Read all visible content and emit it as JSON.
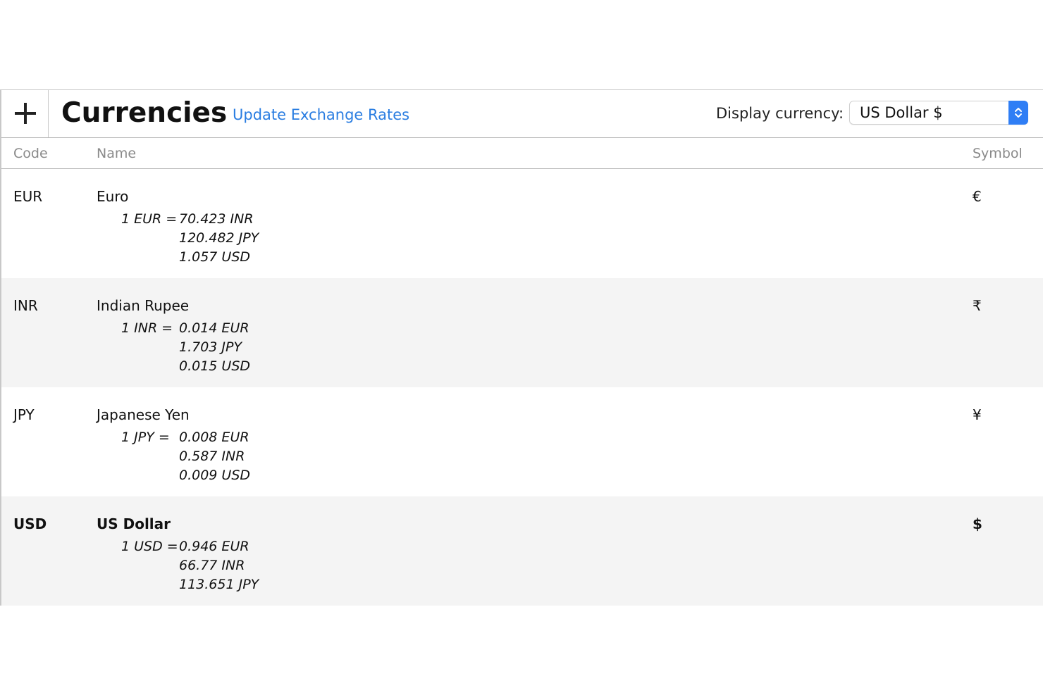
{
  "toolbar": {
    "add_label": "+",
    "title": "Currencies",
    "update_link": "Update Exchange Rates",
    "display_currency_label": "Display currency:",
    "display_currency_value": "US Dollar $"
  },
  "columns": {
    "code": "Code",
    "name": "Name",
    "symbol": "Symbol"
  },
  "rows": [
    {
      "code": "EUR",
      "name": "Euro",
      "symbol": "€",
      "lead": "1 EUR =",
      "rates": [
        "70.423 INR",
        "120.482 JPY",
        "1.057 USD"
      ],
      "selected_display": false
    },
    {
      "code": "INR",
      "name": "Indian Rupee",
      "symbol": "₹",
      "lead": "1 INR =",
      "rates": [
        "0.014 EUR",
        "1.703 JPY",
        "0.015 USD"
      ],
      "selected_display": false
    },
    {
      "code": "JPY",
      "name": "Japanese Yen",
      "symbol": "¥",
      "lead": "1 JPY =",
      "rates": [
        "0.008 EUR",
        "0.587 INR",
        "0.009 USD"
      ],
      "selected_display": false
    },
    {
      "code": "USD",
      "name": "US Dollar",
      "symbol": "$",
      "lead": "1 USD =",
      "rates": [
        "0.946 EUR",
        "66.77 INR",
        "113.651 JPY"
      ],
      "selected_display": true
    }
  ],
  "colors": {
    "link": "#2a7de1",
    "stepper": "#2f7ef5",
    "alt_row": "#f4f4f4",
    "header_text": "#8a8a8a"
  },
  "icons": {
    "add": "plus-icon",
    "stepper": "chevron-up-down-icon"
  }
}
